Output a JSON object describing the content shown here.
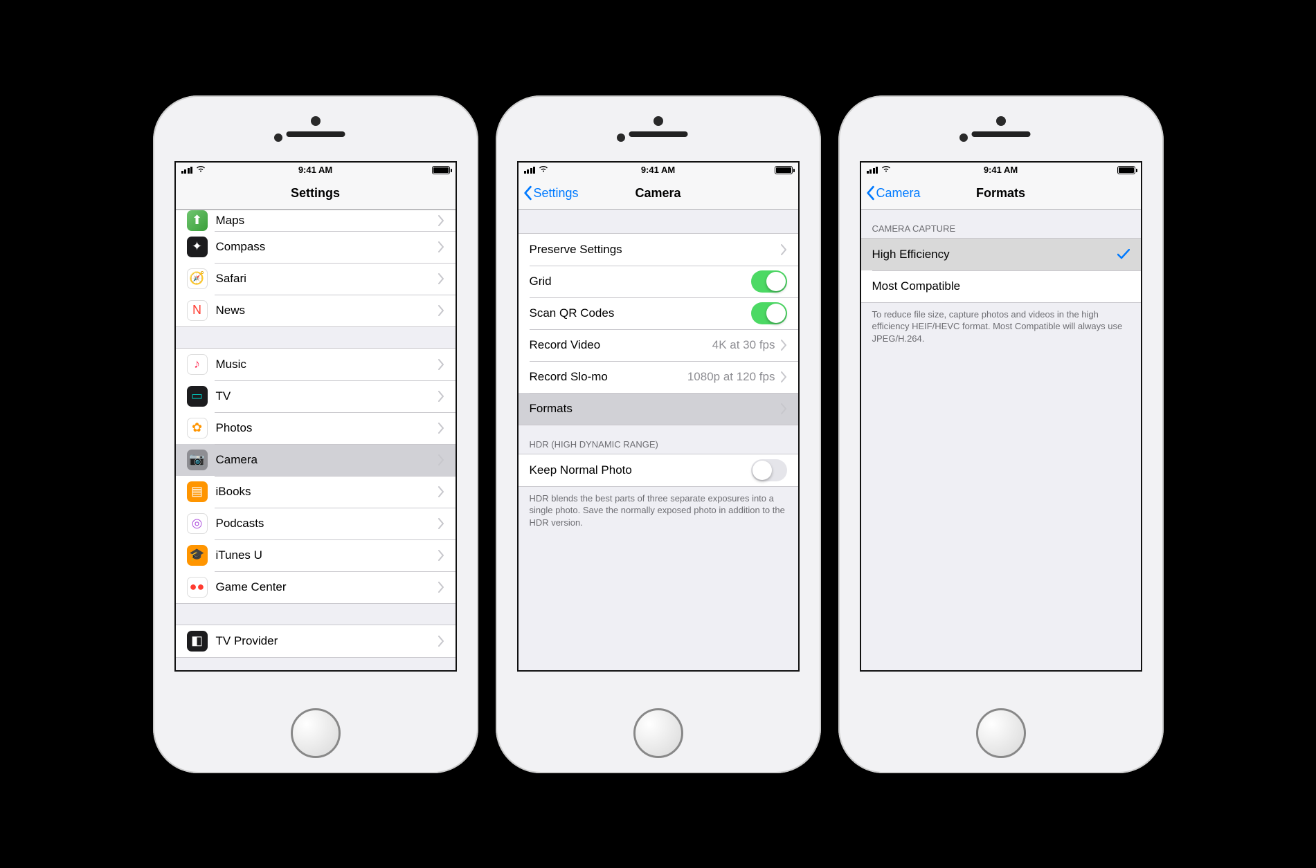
{
  "status": {
    "time": "9:41 AM"
  },
  "phone1": {
    "title": "Settings",
    "groups": [
      {
        "items": [
          {
            "label": "Maps",
            "icon_bg": "linear-gradient(135deg,#6fc56f,#3a9f3a)",
            "glyph": "⬆︎"
          },
          {
            "label": "Compass",
            "icon_bg": "#1c1c1e",
            "glyph": "✦"
          },
          {
            "label": "Safari",
            "icon_bg": "#ffffff",
            "glyph": "🧭",
            "border": true
          },
          {
            "label": "News",
            "icon_bg": "#ffffff",
            "glyph": "N",
            "glyph_color": "#ff3b30",
            "border": true
          }
        ]
      },
      {
        "items": [
          {
            "label": "Music",
            "icon_bg": "#ffffff",
            "glyph": "♪",
            "glyph_color": "#ff2d55",
            "border": true
          },
          {
            "label": "TV",
            "icon_bg": "#1c1c1e",
            "glyph": "▭",
            "glyph_color": "#00c7be"
          },
          {
            "label": "Photos",
            "icon_bg": "#ffffff",
            "glyph": "✿",
            "glyph_color": "#ff9500",
            "border": true
          },
          {
            "label": "Camera",
            "icon_bg": "#8e8e93",
            "glyph": "📷",
            "selected": true
          },
          {
            "label": "iBooks",
            "icon_bg": "#ff9500",
            "glyph": "▤"
          },
          {
            "label": "Podcasts",
            "icon_bg": "#ffffff",
            "glyph": "◎",
            "glyph_color": "#af52de",
            "border": true
          },
          {
            "label": "iTunes U",
            "icon_bg": "#ff9500",
            "glyph": "🎓"
          },
          {
            "label": "Game Center",
            "icon_bg": "#ffffff",
            "glyph": "●●",
            "glyph_color": "#ff3b30",
            "border": true
          }
        ]
      },
      {
        "items": [
          {
            "label": "TV Provider",
            "icon_bg": "#1c1c1e",
            "glyph": "◧"
          }
        ]
      }
    ]
  },
  "phone2": {
    "back": "Settings",
    "title": "Camera",
    "group1": {
      "items": [
        {
          "label": "Preserve Settings",
          "type": "link"
        },
        {
          "label": "Grid",
          "type": "switch",
          "on": true
        },
        {
          "label": "Scan QR Codes",
          "type": "switch",
          "on": true
        },
        {
          "label": "Record Video",
          "type": "link",
          "detail": "4K at 30 fps"
        },
        {
          "label": "Record Slo-mo",
          "type": "link",
          "detail": "1080p at 120 fps"
        },
        {
          "label": "Formats",
          "type": "link",
          "selected": true
        }
      ]
    },
    "group2": {
      "header": "HDR (HIGH DYNAMIC RANGE)",
      "items": [
        {
          "label": "Keep Normal Photo",
          "type": "switch",
          "on": false
        }
      ],
      "footer": "HDR blends the best parts of three separate exposures into a single photo. Save the normally exposed photo in addition to the HDR version."
    }
  },
  "phone3": {
    "back": "Camera",
    "title": "Formats",
    "header": "CAMERA CAPTURE",
    "items": [
      {
        "label": "High Efficiency",
        "checked": true,
        "selected": true
      },
      {
        "label": "Most Compatible",
        "checked": false
      }
    ],
    "footer": "To reduce file size, capture photos and videos in the high efficiency HEIF/HEVC format. Most Compatible will always use JPEG/H.264."
  }
}
